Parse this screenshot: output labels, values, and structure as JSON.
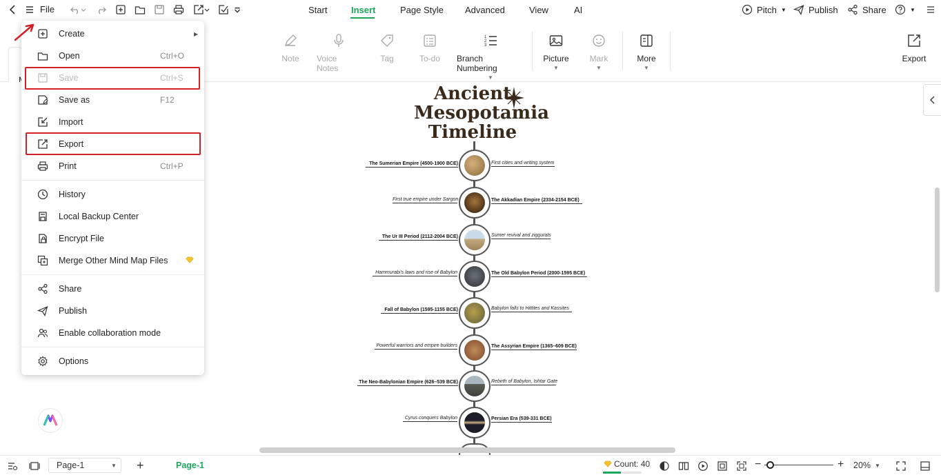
{
  "topbar": {
    "file_label": "File",
    "tabs": [
      "Start",
      "Insert",
      "Page Style",
      "Advanced",
      "View",
      "AI"
    ],
    "active_tab": "Insert",
    "right": {
      "pitch": "Pitch",
      "publish": "Publish",
      "share": "Share"
    }
  },
  "ribbon": {
    "note": "Note",
    "voice_notes": "Voice Notes",
    "tag": "Tag",
    "todo": "To-do",
    "branch_numbering": "Branch Numbering",
    "picture": "Picture",
    "mark": "Mark",
    "more": "More",
    "export": "Export",
    "cut_label": "M"
  },
  "file_menu": {
    "items": [
      {
        "label": "Create",
        "shortcut": ""
      },
      {
        "label": "Open",
        "shortcut": "Ctrl+O"
      },
      {
        "label": "Save",
        "shortcut": "Ctrl+S"
      },
      {
        "label": "Save as",
        "shortcut": "F12"
      },
      {
        "label": "Import",
        "shortcut": ""
      },
      {
        "label": "Export",
        "shortcut": ""
      },
      {
        "label": "Print",
        "shortcut": "Ctrl+P"
      },
      {
        "label": "History",
        "shortcut": ""
      },
      {
        "label": "Local Backup Center",
        "shortcut": ""
      },
      {
        "label": "Encrypt File",
        "shortcut": ""
      },
      {
        "label": "Merge Other Mind Map Files",
        "shortcut": ""
      },
      {
        "label": "Share",
        "shortcut": ""
      },
      {
        "label": "Publish",
        "shortcut": ""
      },
      {
        "label": "Enable collaboration mode",
        "shortcut": ""
      },
      {
        "label": "Options",
        "shortcut": ""
      }
    ],
    "disabled_item": "Save",
    "highlighted_items": [
      "Save",
      "Export"
    ]
  },
  "mindmap": {
    "title": "Ancient Mesopotamia Timeline",
    "title_lines": [
      "Ancient",
      "Mesopotamia",
      "Timeline"
    ],
    "eras": [
      {
        "era": "The Sumerian Empire (4500-1900 BCE)",
        "note": "First cities and writing system"
      },
      {
        "era": "The Akkadian Empire (2334-2154 BCE)",
        "note": "First true empire under Sargon"
      },
      {
        "era": "The Ur III Period (2112-2004 BCE)",
        "note": "Sumer revival and ziggurats"
      },
      {
        "era": "The Old Babylon Period (2000-1595 BCE)",
        "note": "Hammurabi's laws and rise of Babylon"
      },
      {
        "era": "Fall of Babylon (1595-1155 BCE)",
        "note": "Babylon falls to Hittites and Kassites"
      },
      {
        "era": "The Assyrian Empire (1365–609 BCE)",
        "note": "Powerful warriors and empire builders"
      },
      {
        "era": "The Neo-Babylonian Empire (626–539 BCE)",
        "note": "Rebirth of Babylon, Ishtar Gate"
      },
      {
        "era": "Persian Era (539-331 BCE)",
        "note": "Cyrus conquers Babylon"
      }
    ]
  },
  "status": {
    "page_select": "Page-1",
    "page_tab": "Page-1",
    "count": "Count: 40",
    "count_fraction": 0.46,
    "zoom": "20%",
    "zoom_fraction": 0.05
  },
  "colors": {
    "accent": "#1aa75a",
    "highlight": "#d32027"
  }
}
